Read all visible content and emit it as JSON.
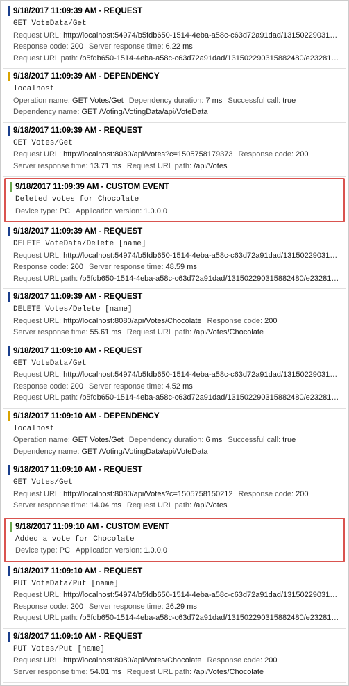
{
  "entries": [
    {
      "bar": "bar-blue",
      "timestamp": "9/18/2017 11:09:39 AM",
      "type": "REQUEST",
      "highlighted": false,
      "lines": [
        {
          "kind": "mono",
          "text": "GET VoteData/Get"
        },
        {
          "kind": "kv",
          "parts": [
            {
              "label": "Request URL",
              "value": "http://localhost:54974/b5fdb650-1514-4eba-a58c-c63d72a91dad/131502290315..."
            }
          ]
        },
        {
          "kind": "kv",
          "parts": [
            {
              "label": "Response code",
              "value": "200"
            },
            {
              "label": "Server response time",
              "value": "6.22 ms"
            }
          ]
        },
        {
          "kind": "kv",
          "parts": [
            {
              "label": "Request URL path",
              "value": "/b5fdb650-1514-4eba-a58c-c63d72a91dad/131502290315882480/e232814..."
            }
          ]
        }
      ]
    },
    {
      "bar": "bar-yellow",
      "timestamp": "9/18/2017 11:09:39 AM",
      "type": "DEPENDENCY",
      "highlighted": false,
      "lines": [
        {
          "kind": "mono",
          "text": "localhost"
        },
        {
          "kind": "kv",
          "parts": [
            {
              "label": "Operation name",
              "value": "GET Votes/Get"
            },
            {
              "label": "Dependency duration",
              "value": "7 ms"
            },
            {
              "label": "Successful call",
              "value": "true"
            }
          ]
        },
        {
          "kind": "kv",
          "parts": [
            {
              "label": "Dependency name",
              "value": "GET /Voting/VotingData/api/VoteData"
            }
          ]
        }
      ]
    },
    {
      "bar": "bar-blue",
      "timestamp": "9/18/2017 11:09:39 AM",
      "type": "REQUEST",
      "highlighted": false,
      "lines": [
        {
          "kind": "mono",
          "text": "GET Votes/Get"
        },
        {
          "kind": "kv",
          "parts": [
            {
              "label": "Request URL",
              "value": "http://localhost:8080/api/Votes?c=1505758179373"
            },
            {
              "label": "Response code",
              "value": "200"
            }
          ]
        },
        {
          "kind": "kv",
          "parts": [
            {
              "label": "Server response time",
              "value": "13.71 ms"
            },
            {
              "label": "Request URL path",
              "value": "/api/Votes"
            }
          ]
        }
      ]
    },
    {
      "bar": "bar-green",
      "timestamp": "9/18/2017 11:09:39 AM",
      "type": "CUSTOM EVENT",
      "highlighted": true,
      "lines": [
        {
          "kind": "mono",
          "text": "Deleted votes for Chocolate"
        },
        {
          "kind": "kv",
          "parts": [
            {
              "label": "Device type",
              "value": "PC"
            },
            {
              "label": "Application version",
              "value": "1.0.0.0"
            }
          ]
        }
      ]
    },
    {
      "bar": "bar-blue",
      "timestamp": "9/18/2017 11:09:39 AM",
      "type": "REQUEST",
      "highlighted": false,
      "lines": [
        {
          "kind": "mono",
          "text": "DELETE VoteData/Delete [name]"
        },
        {
          "kind": "kv",
          "parts": [
            {
              "label": "Request URL",
              "value": "http://localhost:54974/b5fdb650-1514-4eba-a58c-c63d72a91dad/131502290315..."
            }
          ]
        },
        {
          "kind": "kv",
          "parts": [
            {
              "label": "Response code",
              "value": "200"
            },
            {
              "label": "Server response time",
              "value": "48.59 ms"
            }
          ]
        },
        {
          "kind": "kv",
          "parts": [
            {
              "label": "Request URL path",
              "value": "/b5fdb650-1514-4eba-a58c-c63d72a91dad/131502290315882480/e232814..."
            }
          ]
        }
      ]
    },
    {
      "bar": "bar-blue",
      "timestamp": "9/18/2017 11:09:39 AM",
      "type": "REQUEST",
      "highlighted": false,
      "lines": [
        {
          "kind": "mono",
          "text": "DELETE Votes/Delete [name]"
        },
        {
          "kind": "kv",
          "parts": [
            {
              "label": "Request URL",
              "value": "http://localhost:8080/api/Votes/Chocolate"
            },
            {
              "label": "Response code",
              "value": "200"
            }
          ]
        },
        {
          "kind": "kv",
          "parts": [
            {
              "label": "Server response time",
              "value": "55.61 ms"
            },
            {
              "label": "Request URL path",
              "value": "/api/Votes/Chocolate"
            }
          ]
        }
      ]
    },
    {
      "bar": "bar-blue",
      "timestamp": "9/18/2017 11:09:10 AM",
      "type": "REQUEST",
      "highlighted": false,
      "lines": [
        {
          "kind": "mono",
          "text": "GET VoteData/Get"
        },
        {
          "kind": "kv",
          "parts": [
            {
              "label": "Request URL",
              "value": "http://localhost:54974/b5fdb650-1514-4eba-a58c-c63d72a91dad/131502290315..."
            }
          ]
        },
        {
          "kind": "kv",
          "parts": [
            {
              "label": "Response code",
              "value": "200"
            },
            {
              "label": "Server response time",
              "value": "4.52 ms"
            }
          ]
        },
        {
          "kind": "kv",
          "parts": [
            {
              "label": "Request URL path",
              "value": "/b5fdb650-1514-4eba-a58c-c63d72a91dad/131502290315882480/e232814..."
            }
          ]
        }
      ]
    },
    {
      "bar": "bar-yellow",
      "timestamp": "9/18/2017 11:09:10 AM",
      "type": "DEPENDENCY",
      "highlighted": false,
      "lines": [
        {
          "kind": "mono",
          "text": "localhost"
        },
        {
          "kind": "kv",
          "parts": [
            {
              "label": "Operation name",
              "value": "GET Votes/Get"
            },
            {
              "label": "Dependency duration",
              "value": "6 ms"
            },
            {
              "label": "Successful call",
              "value": "true"
            }
          ]
        },
        {
          "kind": "kv",
          "parts": [
            {
              "label": "Dependency name",
              "value": "GET /Voting/VotingData/api/VoteData"
            }
          ]
        }
      ]
    },
    {
      "bar": "bar-blue",
      "timestamp": "9/18/2017 11:09:10 AM",
      "type": "REQUEST",
      "highlighted": false,
      "lines": [
        {
          "kind": "mono",
          "text": "GET Votes/Get"
        },
        {
          "kind": "kv",
          "parts": [
            {
              "label": "Request URL",
              "value": "http://localhost:8080/api/Votes?c=1505758150212"
            },
            {
              "label": "Response code",
              "value": "200"
            }
          ]
        },
        {
          "kind": "kv",
          "parts": [
            {
              "label": "Server response time",
              "value": "14.04 ms"
            },
            {
              "label": "Request URL path",
              "value": "/api/Votes"
            }
          ]
        }
      ]
    },
    {
      "bar": "bar-green",
      "timestamp": "9/18/2017 11:09:10 AM",
      "type": "CUSTOM EVENT",
      "highlighted": true,
      "lines": [
        {
          "kind": "mono",
          "text": "Added a vote for Chocolate"
        },
        {
          "kind": "kv",
          "parts": [
            {
              "label": "Device type",
              "value": "PC"
            },
            {
              "label": "Application version",
              "value": "1.0.0.0"
            }
          ]
        }
      ]
    },
    {
      "bar": "bar-blue",
      "timestamp": "9/18/2017 11:09:10 AM",
      "type": "REQUEST",
      "highlighted": false,
      "lines": [
        {
          "kind": "mono",
          "text": "PUT VoteData/Put [name]"
        },
        {
          "kind": "kv",
          "parts": [
            {
              "label": "Request URL",
              "value": "http://localhost:54974/b5fdb650-1514-4eba-a58c-c63d72a91dad/131502290315..."
            }
          ]
        },
        {
          "kind": "kv",
          "parts": [
            {
              "label": "Response code",
              "value": "200"
            },
            {
              "label": "Server response time",
              "value": "26.29 ms"
            }
          ]
        },
        {
          "kind": "kv",
          "parts": [
            {
              "label": "Request URL path",
              "value": "/b5fdb650-1514-4eba-a58c-c63d72a91dad/131502290315882480/e232814..."
            }
          ]
        }
      ]
    },
    {
      "bar": "bar-blue",
      "timestamp": "9/18/2017 11:09:10 AM",
      "type": "REQUEST",
      "highlighted": false,
      "lines": [
        {
          "kind": "mono",
          "text": "PUT Votes/Put [name]"
        },
        {
          "kind": "kv",
          "parts": [
            {
              "label": "Request URL",
              "value": "http://localhost:8080/api/Votes/Chocolate"
            },
            {
              "label": "Response code",
              "value": "200"
            }
          ]
        },
        {
          "kind": "kv",
          "parts": [
            {
              "label": "Server response time",
              "value": "54.01 ms"
            },
            {
              "label": "Request URL path",
              "value": "/api/Votes/Chocolate"
            }
          ]
        }
      ]
    }
  ]
}
